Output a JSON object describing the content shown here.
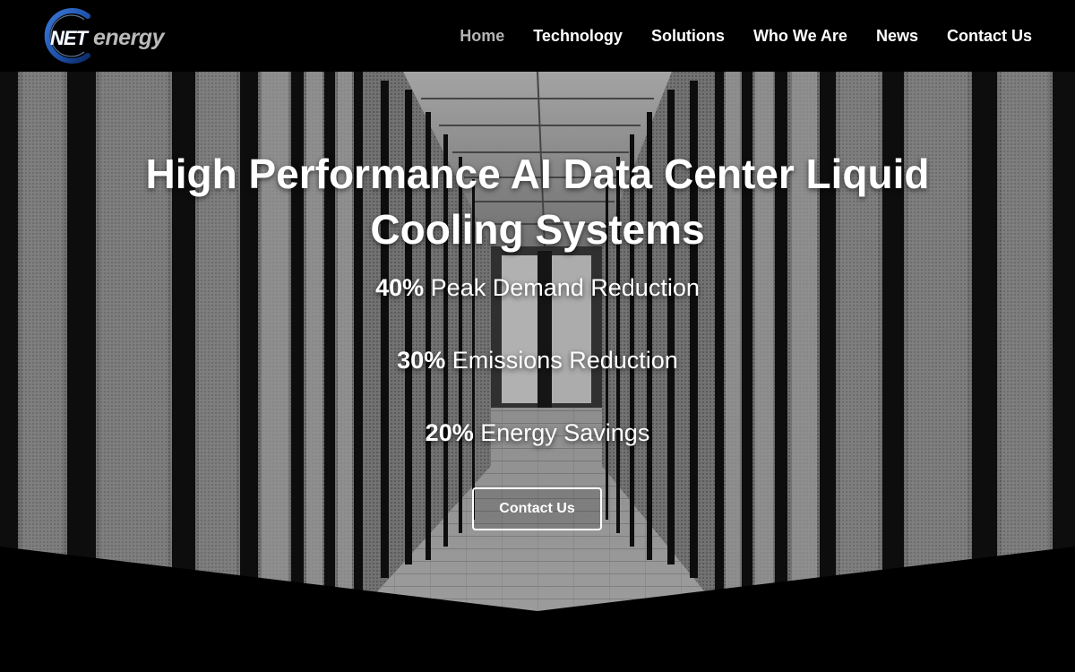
{
  "brand": {
    "logo_prefix": "NET",
    "logo_suffix": "energy",
    "accent_color": "#1d4fa8"
  },
  "nav": {
    "items": [
      {
        "label": "Home",
        "active": true
      },
      {
        "label": "Technology",
        "active": false
      },
      {
        "label": "Solutions",
        "active": false
      },
      {
        "label": "Who We Are",
        "active": false
      },
      {
        "label": "News",
        "active": false
      },
      {
        "label": "Contact Us",
        "active": false
      }
    ]
  },
  "hero": {
    "title": "High Performance AI Data Center Liquid Cooling Systems",
    "stats": [
      {
        "value": "40%",
        "label": " Peak Demand Reduction"
      },
      {
        "value": "30%",
        "label": " Emissions Reduction"
      },
      {
        "value": "20%",
        "label": " Energy Savings"
      }
    ],
    "cta_label": "Contact Us",
    "background_icon": "data-center-aisle-photo"
  }
}
